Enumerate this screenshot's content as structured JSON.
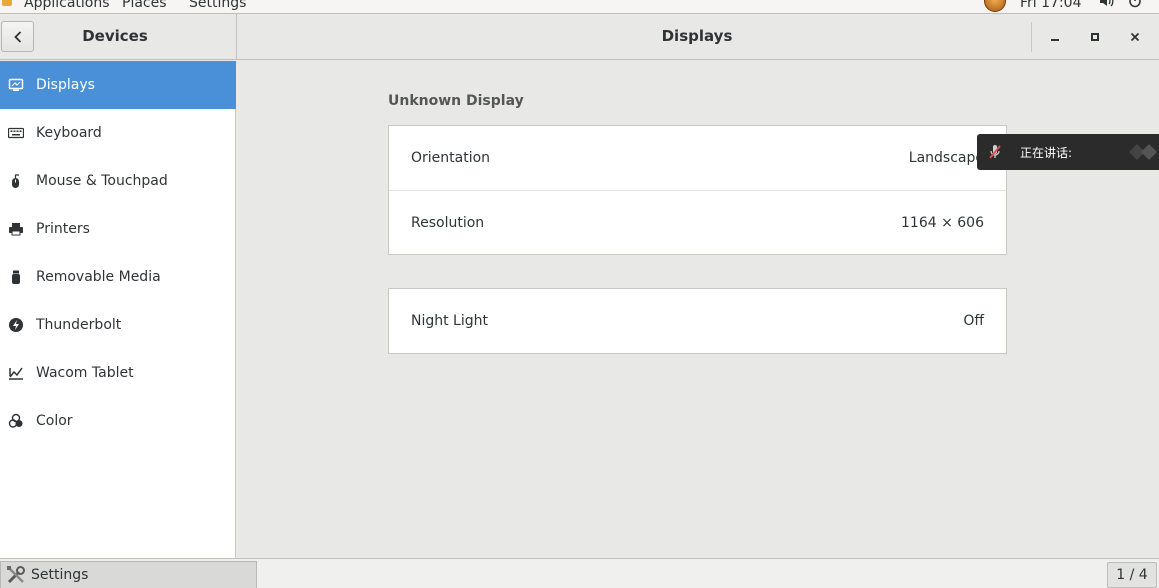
{
  "topbar": {
    "menus": [
      "Applications",
      "Places",
      "Settings"
    ],
    "clock": "Fri 17:04"
  },
  "header": {
    "sidebar_title": "Devices",
    "main_title": "Displays"
  },
  "sidebar": {
    "items": [
      {
        "label": "Displays",
        "icon": "display-icon",
        "active": true
      },
      {
        "label": "Keyboard",
        "icon": "keyboard-icon"
      },
      {
        "label": "Mouse & Touchpad",
        "icon": "mouse-icon"
      },
      {
        "label": "Printers",
        "icon": "printer-icon"
      },
      {
        "label": "Removable Media",
        "icon": "removable-media-icon"
      },
      {
        "label": "Thunderbolt",
        "icon": "thunderbolt-icon"
      },
      {
        "label": "Wacom Tablet",
        "icon": "tablet-icon"
      },
      {
        "label": "Color",
        "icon": "color-icon"
      }
    ]
  },
  "main": {
    "section_title": "Unknown Display",
    "display_rows": [
      {
        "label": "Orientation",
        "value": "Landscape"
      },
      {
        "label": "Resolution",
        "value": "1164 × 606"
      }
    ],
    "night_light": {
      "label": "Night Light",
      "value": "Off"
    }
  },
  "notification": {
    "text": "正在讲话:"
  },
  "taskbar": {
    "task_label": "Settings",
    "pager": "1 / 4"
  },
  "colors": {
    "accent": "#4a90d9",
    "background": "#e8e8e7",
    "panel": "#ffffff",
    "notification_bg": "#2b2b2b"
  }
}
